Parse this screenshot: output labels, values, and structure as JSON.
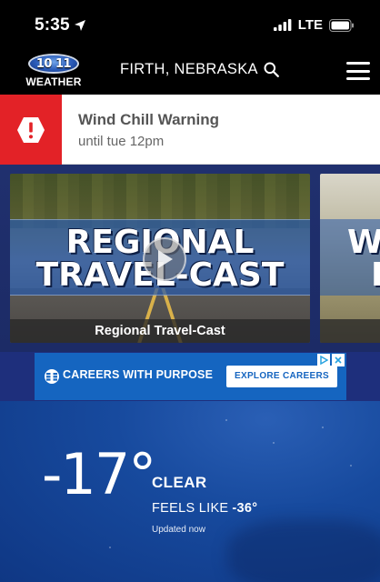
{
  "status_bar": {
    "time": "5:35",
    "network": "LTE"
  },
  "header": {
    "logo_number": "10 11",
    "logo_word": "WEATHER",
    "location": "FIRTH, NEBRASKA"
  },
  "alert": {
    "title": "Wind Chill Warning",
    "subtitle": "until tue 12pm",
    "color": "#e32227"
  },
  "videos": [
    {
      "graphic_line1": "REGIONAL",
      "graphic_line2": "TRAVEL-CAST",
      "caption": "Regional Travel-Cast"
    },
    {
      "graphic_line1": "W",
      "graphic_line2": "F",
      "caption": ""
    }
  ],
  "ad": {
    "headline": "CAREERS WITH PURPOSE",
    "cta": "EXPLORE CAREERS"
  },
  "conditions": {
    "temperature": "-17°",
    "condition": "CLEAR",
    "feels_like_label": "FEELS LIKE",
    "feels_like_value": "-36°",
    "updated": "Updated now"
  }
}
